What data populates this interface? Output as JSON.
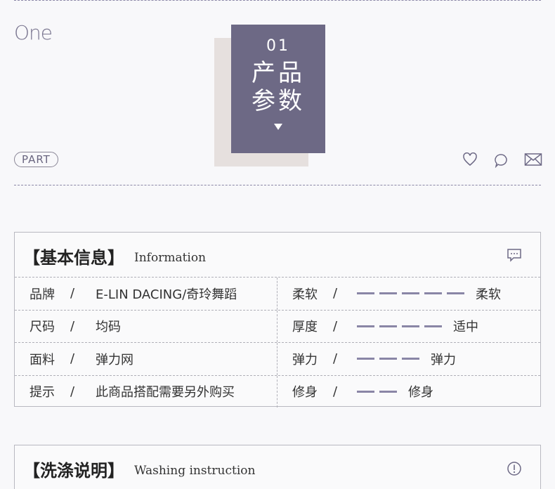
{
  "header": {
    "one": "One",
    "part": "PART",
    "number": "01",
    "title_line1": "产品",
    "title_line2": "参数"
  },
  "colors": {
    "accent": "#6d6985",
    "shadow": "#e6e0de",
    "dash": "#8a86a6"
  },
  "info": {
    "title": "【基本信息】",
    "subtitle": "Information",
    "rows": [
      {
        "label": "品牌",
        "slash": "/",
        "value": "E-LIN DACING/奇玲舞蹈",
        "r_label": "柔软",
        "r_slash": "/",
        "r_dashes": 5,
        "r_value": "柔软"
      },
      {
        "label": "尺码",
        "slash": "/",
        "value": "均码",
        "r_label": "厚度",
        "r_slash": "/",
        "r_dashes": 4,
        "r_value": "适中"
      },
      {
        "label": "面料",
        "slash": "/",
        "value": "弹力网",
        "r_label": "弹力",
        "r_slash": "/",
        "r_dashes": 3,
        "r_value": "弹力"
      },
      {
        "label": "提示",
        "slash": "/",
        "value": "此商品搭配需要另外购买",
        "r_label": "修身",
        "r_slash": "/",
        "r_dashes": 2,
        "r_value": "修身"
      }
    ]
  },
  "washing": {
    "title": "【洗涤说明】",
    "subtitle": "Washing instruction"
  }
}
